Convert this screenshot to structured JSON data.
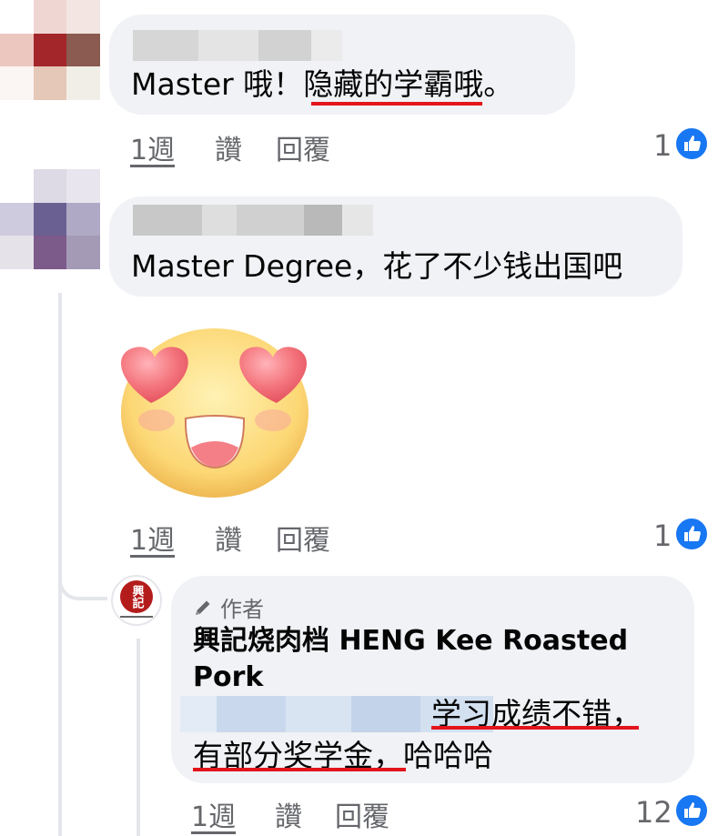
{
  "colors": {
    "bubble_bg": "#f0f2f5",
    "meta_text": "#65676b",
    "like_blue": "#1877f2",
    "underline_red": "#e4141b",
    "avatar3_red": "#b41c1c"
  },
  "comments": [
    {
      "text_before": "Master 哦！",
      "text_highlight": "隐藏的学霸",
      "text_after": "哦。",
      "time_label": "1週",
      "like_label": "讚",
      "reply_label": "回覆",
      "reaction_count": "1",
      "reaction_icon": "thumbs-up-icon"
    },
    {
      "text": "Master Degree，花了不少钱出国吧",
      "sticker_icon": "heart-eyes-emoji-icon",
      "time_label": "1週",
      "like_label": "讚",
      "reply_label": "回覆",
      "reaction_count": "1",
      "reaction_icon": "thumbs-up-icon"
    }
  ],
  "reply": {
    "author_badge": "作者",
    "author_badge_icon": "pencil-icon",
    "author_name": "興記烧肉档 HENG Kee Roasted Pork",
    "avatar_text": "興記",
    "line1_highlight": "学习成绩不错",
    "line1_after": "，",
    "line2_highlight": "有部分奖学金",
    "line2_after": "，哈哈哈",
    "time_label": "1週",
    "like_label": "讚",
    "reply_label": "回覆",
    "reaction_count": "12",
    "reaction_icon": "thumbs-up-icon"
  }
}
